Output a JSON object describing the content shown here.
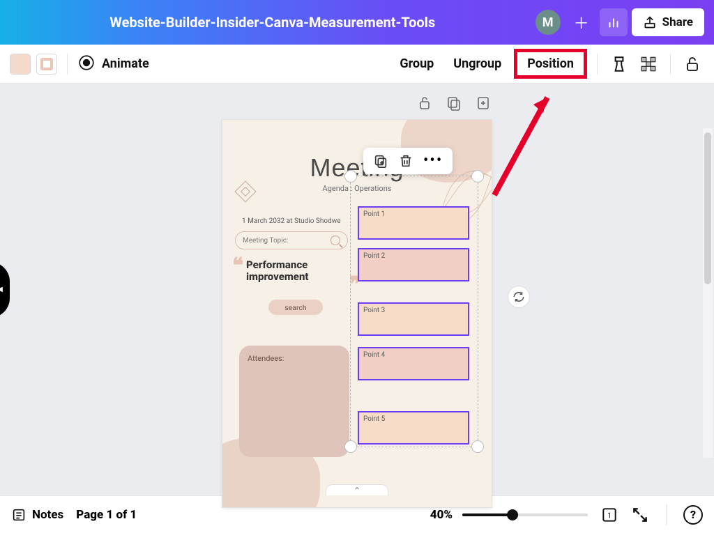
{
  "colors": {
    "highlight_red": "#e4002b",
    "selection_purple": "#6b3df5"
  },
  "topbar": {
    "design_title": "Website-Builder-Insider-Canva-Measurement-Tools",
    "avatar_initial": "M",
    "share_label": "Share"
  },
  "toolbar": {
    "animate_label": "Animate",
    "group_label": "Group",
    "ungroup_label": "Ungroup",
    "position_label": "Position"
  },
  "context_toolbar": {
    "items": [
      "duplicate",
      "delete",
      "more"
    ]
  },
  "page": {
    "title": "Meeting",
    "subtitle": "Agenda : Operations",
    "date_line": "1 March 2032 at Studio Shodwe",
    "topic_label": "Meeting Topic:",
    "quote_line1": "Performance",
    "quote_line2": "improvement",
    "search_pill": "search",
    "attendees_label": "Attendees:",
    "points": [
      "Point 1",
      "Point 2",
      "Point 3",
      "Point 4",
      "Point 5"
    ]
  },
  "bottombar": {
    "notes_label": "Notes",
    "page_indicator": "Page 1 of 1",
    "zoom_pct": "40%",
    "help_glyph": "?"
  }
}
